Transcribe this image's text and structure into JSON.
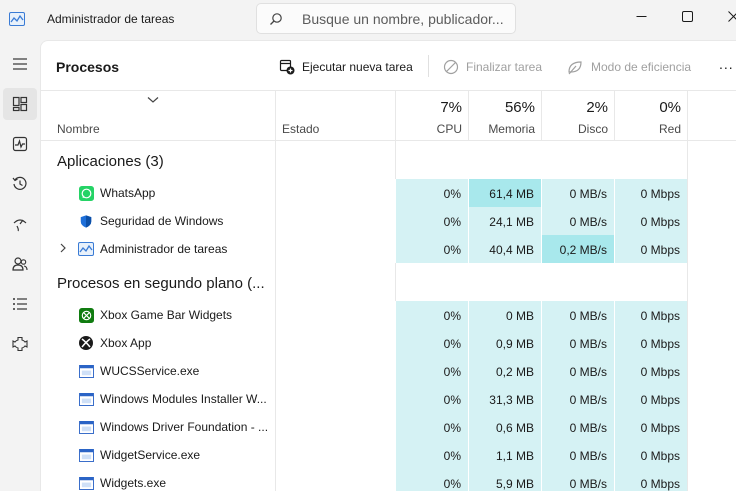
{
  "window": {
    "title": "Administrador de tareas"
  },
  "search": {
    "placeholder": "Busque un nombre, publicador..."
  },
  "nav": {
    "items": [
      {
        "name": "menu-icon"
      },
      {
        "name": "processes-icon"
      },
      {
        "name": "performance-icon"
      },
      {
        "name": "history-icon"
      },
      {
        "name": "startup-icon"
      },
      {
        "name": "users-icon"
      },
      {
        "name": "details-icon"
      },
      {
        "name": "services-icon"
      }
    ]
  },
  "toolbar": {
    "page_title": "Procesos",
    "run_task": "Ejecutar nueva tarea",
    "end_task": "Finalizar tarea",
    "efficiency_mode": "Modo de eficiencia",
    "more": "..."
  },
  "columns": {
    "name": "Nombre",
    "status": "Estado",
    "cpu": {
      "pct": "7%",
      "label": "CPU"
    },
    "memory": {
      "pct": "56%",
      "label": "Memoria"
    },
    "disk": {
      "pct": "2%",
      "label": "Disco"
    },
    "network": {
      "pct": "0%",
      "label": "Red"
    }
  },
  "groups": {
    "apps": "Aplicaciones (3)",
    "background": "Procesos en segundo plano (..."
  },
  "apps": [
    {
      "name": "WhatsApp",
      "icon": "whatsapp-icon",
      "cpu": "0%",
      "memory": "61,4 MB",
      "disk": "0 MB/s",
      "network": "0 Mbps"
    },
    {
      "name": "Seguridad de Windows",
      "icon": "shield-icon",
      "cpu": "0%",
      "memory": "24,1 MB",
      "disk": "0 MB/s",
      "network": "0 Mbps"
    },
    {
      "name": "Administrador de tareas",
      "icon": "task-manager-icon",
      "cpu": "0%",
      "memory": "40,4 MB",
      "disk": "0,2 MB/s",
      "network": "0 Mbps"
    }
  ],
  "background": [
    {
      "name": "Xbox Game Bar Widgets",
      "icon": "xbox-game-bar-icon",
      "cpu": "0%",
      "memory": "0 MB",
      "disk": "0 MB/s",
      "network": "0 Mbps"
    },
    {
      "name": "Xbox App",
      "icon": "xbox-icon",
      "cpu": "0%",
      "memory": "0,9 MB",
      "disk": "0 MB/s",
      "network": "0 Mbps"
    },
    {
      "name": "WUCSService.exe",
      "icon": "window-app-icon",
      "cpu": "0%",
      "memory": "0,2 MB",
      "disk": "0 MB/s",
      "network": "0 Mbps"
    },
    {
      "name": "Windows Modules Installer W...",
      "icon": "window-app-icon",
      "cpu": "0%",
      "memory": "31,3 MB",
      "disk": "0 MB/s",
      "network": "0 Mbps"
    },
    {
      "name": "Windows Driver Foundation - ...",
      "icon": "window-app-icon",
      "cpu": "0%",
      "memory": "0,6 MB",
      "disk": "0 MB/s",
      "network": "0 Mbps"
    },
    {
      "name": "WidgetService.exe",
      "icon": "window-app-icon",
      "cpu": "0%",
      "memory": "1,1 MB",
      "disk": "0 MB/s",
      "network": "0 Mbps"
    },
    {
      "name": "Widgets.exe",
      "icon": "window-app-icon",
      "cpu": "0%",
      "memory": "5,9 MB",
      "disk": "0 MB/s",
      "network": "0 Mbps"
    }
  ],
  "colors": {
    "cell": "#d5f2f4",
    "cell_hot": "#a8e8ec",
    "background": "#f3f3f3"
  }
}
